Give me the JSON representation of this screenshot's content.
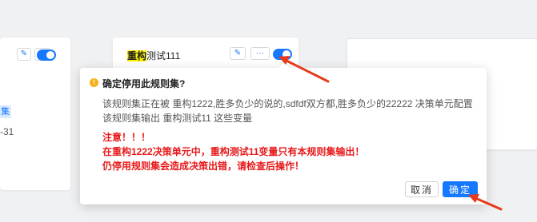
{
  "background_cards": {
    "left": {
      "edit_icon": "pencil-icon",
      "more_label": "···",
      "tag_text": "集",
      "date_fragment": "-31"
    },
    "mid": {
      "title_highlight": "重构",
      "title_rest": "测试111",
      "edit_icon": "pencil-icon",
      "more_label": "···"
    }
  },
  "popconfirm": {
    "icon": "warning-icon",
    "title": "确定停用此规则集?",
    "description_line1": "该规则集正在被 重构1222,胜多负少的说的,sdfdf双方都,胜多负少的22222 决策单元配置",
    "description_line2": "该规则集输出 重构测试11 这些变量",
    "warning_line1": "注意！！！",
    "warning_line2": "在重构1222决策单元中，重构测试11变量只有本规则集输出！",
    "warning_line3": "仍停用规则集会造成决策出错，请检查后操作！",
    "cancel_label": "取消",
    "ok_label": "确定"
  },
  "colors": {
    "accent": "#1677ff",
    "warning_text": "#e8191a",
    "warning_icon": "#faad14",
    "highlight": "#fff200",
    "annotation_arrow": "#e8391b"
  }
}
